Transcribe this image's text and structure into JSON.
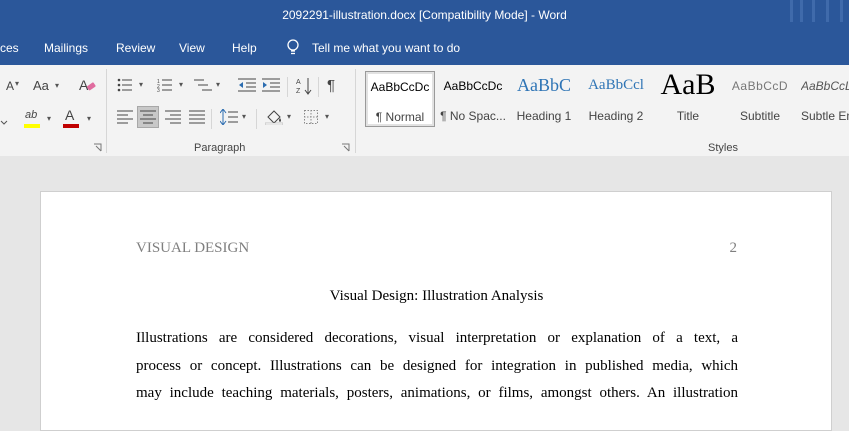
{
  "window": {
    "title": "2092291-illustration.docx [Compatibility Mode]  -  Word"
  },
  "menu": {
    "items": [
      "ces",
      "Mailings",
      "Review",
      "View",
      "Help"
    ],
    "tell_me": "Tell me what you want to do"
  },
  "ribbon": {
    "font_group": {
      "font_size_glyph": "A",
      "change_case": "Aa",
      "highlight_glyph": "ab",
      "font_color_glyph": "A",
      "highlight_color": "#ffff00",
      "font_color": "#c00000"
    },
    "paragraph_group": {
      "label": "Paragraph",
      "pilcrow": "¶"
    },
    "styles_group": {
      "label": "Styles",
      "styles": [
        {
          "preview": "AaBbCcDc",
          "name": "¶ Normal"
        },
        {
          "preview": "AaBbCcDc",
          "name": "¶ No Spac..."
        },
        {
          "preview": "AaBbC",
          "name": "Heading 1"
        },
        {
          "preview": "AaBbCcl",
          "name": "Heading 2"
        },
        {
          "preview": "AaB",
          "name": "Title"
        },
        {
          "preview": "AaBbCcD",
          "name": "Subtitle"
        },
        {
          "preview": "AaBbCcL",
          "name": "Subtle Em"
        }
      ]
    }
  },
  "document": {
    "header_left": "VISUAL DESIGN",
    "page_number": "2",
    "title": "Visual Design: Illustration Analysis",
    "lines": [
      "Illustrations are considered decorations, visual interpretation or explanation of a text, a",
      "process or concept. Illustrations can be designed for integration in published media, which",
      "may include teaching materials, posters, animations, or films, amongst others. An illustration"
    ]
  },
  "colors": {
    "brand": "#2b579a",
    "ribbon_bg": "#f3f3f3",
    "canvas_bg": "#e6e6e6"
  }
}
